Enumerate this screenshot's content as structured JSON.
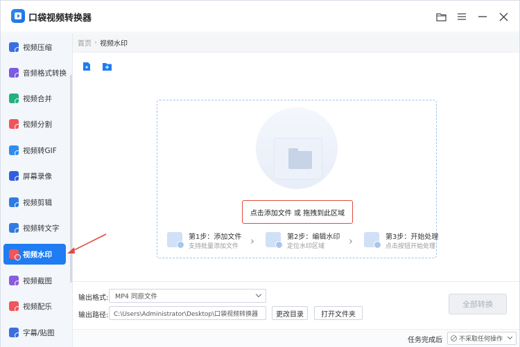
{
  "app": {
    "title": "口袋视频转换器"
  },
  "titlebar": {
    "folder_icon": "folder-icon",
    "menu_icon": "menu-icon",
    "minimize_icon": "minimize-icon",
    "close_icon": "close-icon"
  },
  "sidebar": {
    "items": [
      {
        "label": "视频压缩",
        "icon": "compress-icon",
        "color": "#3b6fe0"
      },
      {
        "label": "音频格式转换",
        "icon": "audio-convert-icon",
        "color": "#7b5be0"
      },
      {
        "label": "视频合并",
        "icon": "merge-icon",
        "color": "#22b07d"
      },
      {
        "label": "视频分割",
        "icon": "split-icon",
        "color": "#f0555a"
      },
      {
        "label": "视频转GIF",
        "icon": "gif-icon",
        "color": "#2f8cf0"
      },
      {
        "label": "屏幕录像",
        "icon": "record-icon",
        "color": "#2f5fe0"
      },
      {
        "label": "视频剪辑",
        "icon": "clip-icon",
        "color": "#2f7ce0"
      },
      {
        "label": "视频转文字",
        "icon": "to-text-icon",
        "color": "#2f7ce0"
      },
      {
        "label": "视频水印",
        "icon": "watermark-icon",
        "color": "#f0555a",
        "active": true
      },
      {
        "label": "视频截图",
        "icon": "screenshot-icon",
        "color": "#8a5be0"
      },
      {
        "label": "视频配乐",
        "icon": "music-icon",
        "color": "#f0555a"
      },
      {
        "label": "字幕/贴图",
        "icon": "subtitle-icon",
        "color": "#3b6fe0"
      }
    ]
  },
  "breadcrumb": {
    "home": "首页",
    "separator": "›",
    "current": "视频水印"
  },
  "toolbar": {
    "add_file_icon": "add-file-icon",
    "add_folder_icon": "add-folder-icon"
  },
  "dropzone": {
    "hint": "点击添加文件 或 拖拽到此区域",
    "steps": [
      {
        "title": "第1步：添加文件",
        "sub": "支持批量添加文件"
      },
      {
        "title": "第2步：编辑水印",
        "sub": "定位水印区域"
      },
      {
        "title": "第3步：开始处理",
        "sub": "点击按钮开始处理"
      }
    ]
  },
  "bottom": {
    "format_label": "输出格式:",
    "format_value": "MP4  同原文件",
    "path_label": "输出路径:",
    "path_value": "C:\\Users\\Administrator\\Desktop\\口袋视频转换器",
    "change_dir": "更改目录",
    "open_folder": "打开文件夹",
    "convert_all": "全部转换"
  },
  "status": {
    "after_label": "任务完成后",
    "after_value": "不采取任何操作"
  },
  "colors": {
    "accent": "#1f7cf2",
    "highlight": "#e04b3c"
  }
}
